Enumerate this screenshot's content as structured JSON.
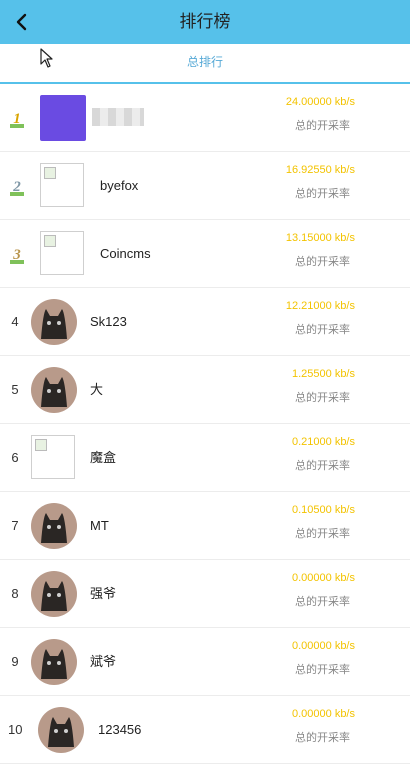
{
  "header": {
    "title": "排行榜"
  },
  "tabs": [
    {
      "label": "总排行"
    }
  ],
  "colors": {
    "accent": "#56c1ea",
    "rate": "#f3c300"
  },
  "list": [
    {
      "rank": "1",
      "name": "",
      "avatar": "blurred-avatar",
      "rate": "24.00000 kb/s",
      "sub": "总的开采率"
    },
    {
      "rank": "2",
      "name": "byefox",
      "avatar": "broken-image-icon",
      "rate": "16.92550 kb/s",
      "sub": "总的开采率"
    },
    {
      "rank": "3",
      "name": "Coincms",
      "avatar": "broken-image-icon",
      "rate": "13.15000 kb/s",
      "sub": "总的开采率"
    },
    {
      "rank": "4",
      "name": "Sk123",
      "avatar": "cat-avatar",
      "rate": "12.21000 kb/s",
      "sub": "总的开采率"
    },
    {
      "rank": "5",
      "name": "大",
      "avatar": "cat-avatar",
      "rate": "1.25500 kb/s",
      "sub": "总的开采率"
    },
    {
      "rank": "6",
      "name": "魔盒",
      "avatar": "broken-image-icon",
      "rate": "0.21000 kb/s",
      "sub": "总的开采率"
    },
    {
      "rank": "7",
      "name": "MT",
      "avatar": "cat-avatar",
      "rate": "0.10500 kb/s",
      "sub": "总的开采率"
    },
    {
      "rank": "8",
      "name": "强爷",
      "avatar": "cat-avatar",
      "rate": "0.00000 kb/s",
      "sub": "总的开采率"
    },
    {
      "rank": "9",
      "name": "斌爷",
      "avatar": "cat-avatar",
      "rate": "0.00000 kb/s",
      "sub": "总的开采率"
    },
    {
      "rank": "10",
      "name": "123456",
      "avatar": "cat-avatar",
      "rate": "0.00000 kb/s",
      "sub": "总的开采率"
    }
  ]
}
